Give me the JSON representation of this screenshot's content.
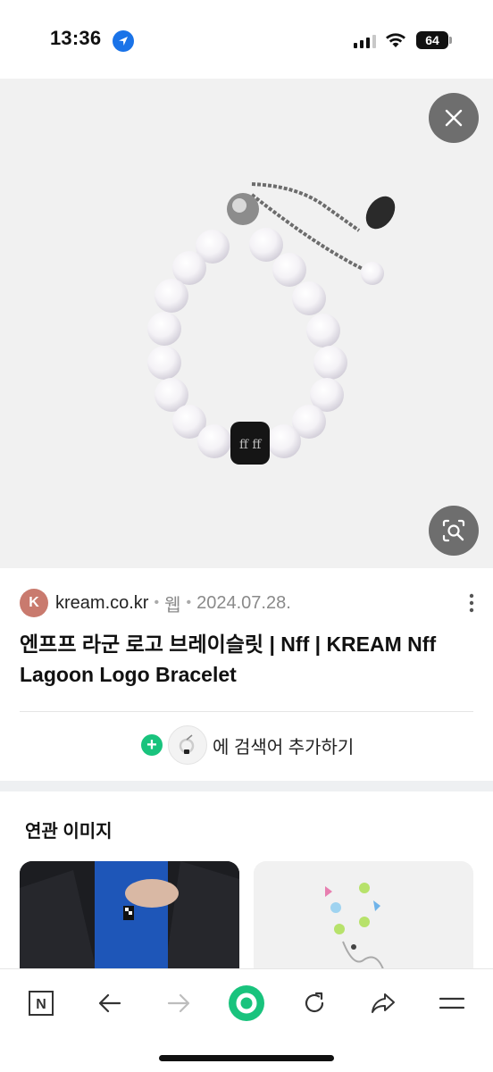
{
  "status": {
    "time": "13:36",
    "battery": "64"
  },
  "source": {
    "favicon_letter": "K",
    "site": "kream.co.kr",
    "type": "웹",
    "date": "2024.07.28."
  },
  "result": {
    "title": "엔프프 라군 로고 브레이슬릿 | Nff | KREAM Nff Lagoon Logo Bracelet"
  },
  "add_search": {
    "label": "에 검색어 추가하기"
  },
  "related": {
    "title": "연관 이미지"
  },
  "colors": {
    "accent_green": "#19c37d",
    "location_blue": "#1a73e8",
    "favicon_bg": "#c97a6e"
  },
  "icons": {
    "close": "close-icon",
    "lens": "image-search-icon",
    "more": "more-vertical-icon",
    "nav_home": "naver-n-icon",
    "back": "arrow-left-icon",
    "forward": "arrow-right-icon",
    "green_dot": "green-dot-icon",
    "refresh": "refresh-icon",
    "share": "share-icon",
    "menu": "menu-icon"
  }
}
